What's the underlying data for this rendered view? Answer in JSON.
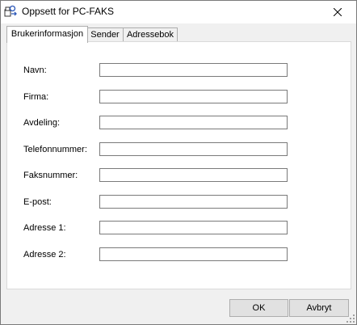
{
  "window": {
    "title": "Oppsett for PC-FAKS"
  },
  "tabs": [
    {
      "label": "Brukerinformasjon"
    },
    {
      "label": "Sender"
    },
    {
      "label": "Adressebok"
    }
  ],
  "form": {
    "fields": [
      {
        "label": "Navn:",
        "value": ""
      },
      {
        "label": "Firma:",
        "value": ""
      },
      {
        "label": "Avdeling:",
        "value": ""
      },
      {
        "label": "Telefonnummer:",
        "value": ""
      },
      {
        "label": "Faksnummer:",
        "value": ""
      },
      {
        "label": "E-post:",
        "value": ""
      },
      {
        "label": "Adresse 1:",
        "value": ""
      },
      {
        "label": "Adresse 2:",
        "value": ""
      }
    ]
  },
  "buttons": {
    "ok": "OK",
    "cancel": "Avbryt"
  },
  "icons": {
    "app": "fax-setup-icon",
    "close": "close-icon",
    "resize": "resize-grip-icon"
  }
}
